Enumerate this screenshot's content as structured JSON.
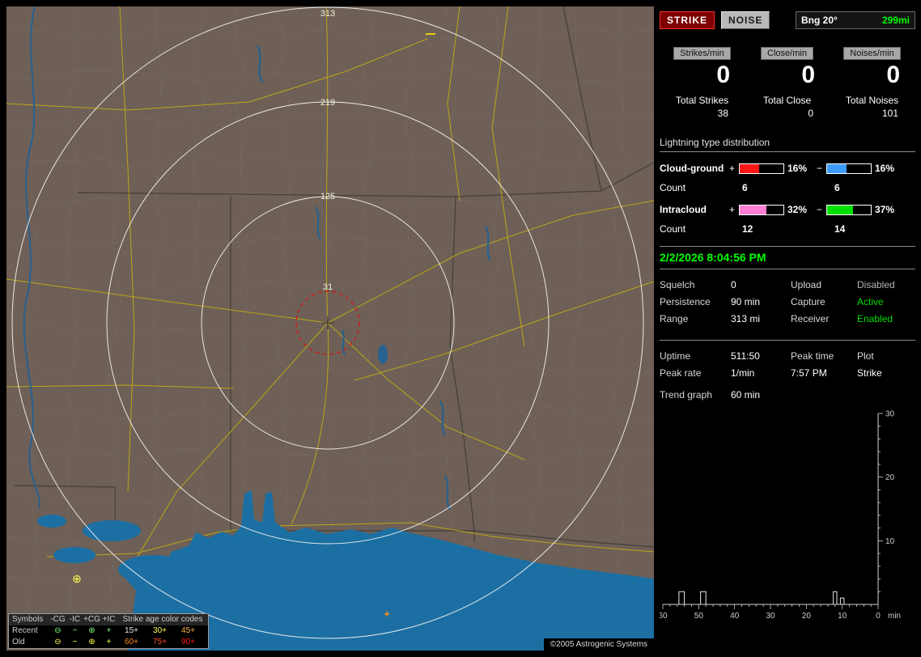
{
  "map": {
    "rings": [
      "313",
      "219",
      "125",
      "31"
    ],
    "markers": [
      {
        "glyph": "⊕",
        "color": "#ffff4d"
      },
      {
        "glyph": "+",
        "color": "#ff8c1a"
      }
    ],
    "legend": {
      "header": {
        "symbols": "Symbols",
        "cols": [
          "-CG",
          "-IC",
          "+CG",
          "+IC"
        ],
        "age_title": "Strike age color codes"
      },
      "rows": [
        {
          "label": "Recent",
          "symbols": [
            "⊖",
            "−",
            "⊕",
            "+"
          ],
          "symbol_color": "#7fff7f",
          "ages": [
            {
              "text": "15+",
              "color": "#e8e8e8"
            },
            {
              "text": "30+",
              "color": "#ffff4d"
            },
            {
              "text": "45+",
              "color": "#ffb347"
            }
          ]
        },
        {
          "label": "Old",
          "symbols": [
            "⊖",
            "−",
            "⊕",
            "+"
          ],
          "symbol_color": "#ffff4d",
          "ages": [
            {
              "text": "60+",
              "color": "#ff8c1a"
            },
            {
              "text": "75+",
              "color": "#ff4d26"
            },
            {
              "text": "90+",
              "color": "#ff1f1f"
            }
          ]
        }
      ]
    },
    "copyright": "©2005 Astrogenic Systems"
  },
  "panel": {
    "strike_button": "STRIKE",
    "noise_button": "NOISE",
    "bng_label": "Bng 20°",
    "bng_range": "299mi",
    "bng_range_color": "#00ff00",
    "counters": [
      {
        "label": "Strikes/min",
        "value": "0",
        "total_label": "Total Strikes",
        "total": "38"
      },
      {
        "label": "Close/min",
        "value": "0",
        "total_label": "Total Close",
        "total": "0"
      },
      {
        "label": "Noises/min",
        "value": "0",
        "total_label": "Total Noises",
        "total": "101"
      }
    ],
    "distribution": {
      "title": "Lightning type distribution",
      "rows": [
        {
          "name": "Cloud-ground",
          "plus_sign": "+",
          "minus_sign": "−",
          "plus_pct": "16%",
          "minus_pct": "16%",
          "plus_fill": "45%",
          "minus_fill": "45%",
          "plus_color": "#ff1515",
          "minus_color": "#3d9bff",
          "count_label": "Count",
          "plus_count": "6",
          "minus_count": "6"
        },
        {
          "name": "Intracloud",
          "plus_sign": "+",
          "minus_sign": "−",
          "plus_pct": "32%",
          "minus_pct": "37%",
          "plus_fill": "62%",
          "minus_fill": "60%",
          "plus_color": "#ff7fd4",
          "minus_color": "#00e000",
          "count_label": "Count",
          "plus_count": "12",
          "minus_count": "14"
        }
      ]
    },
    "timestamp": "2/2/2026 8:04:56 PM",
    "timestamp_color": "#00ff00",
    "status": {
      "rows": [
        {
          "l1": "Squelch",
          "v1": "0",
          "l2": "Upload",
          "v2": "Disabled",
          "v2_color": "#b4b4b4"
        },
        {
          "l1": "Persistence",
          "v1": "90 min",
          "l2": "Capture",
          "v2": "Active",
          "v2_color": "#00dd00"
        },
        {
          "l1": "Range",
          "v1": "313 mi",
          "l2": "Receiver",
          "v2": "Enabled",
          "v2_color": "#00dd00"
        }
      ]
    },
    "stats": {
      "uptime_label": "Uptime",
      "uptime": "511:50",
      "peak_time_label": "Peak time",
      "plot_label": "Plot",
      "peak_rate_label": "Peak rate",
      "peak_rate": "1/min",
      "peak_time": "7:57 PM",
      "plot": "Strike",
      "trend_label": "Trend graph",
      "trend_value": "60 min"
    }
  },
  "chart_data": {
    "type": "line",
    "title": "Strike trend graph, last 60 minutes",
    "xlabel": "min",
    "x_ticks": [
      60,
      50,
      40,
      30,
      20,
      10,
      0
    ],
    "y_ticks": [
      10,
      20,
      30
    ],
    "xlim": [
      60,
      0
    ],
    "ylim": [
      0,
      30
    ],
    "grid": false,
    "series": [
      {
        "name": "Strike",
        "pulses": [
          {
            "from_min": 55.5,
            "to_min": 54,
            "value": 2
          },
          {
            "from_min": 49.5,
            "to_min": 48,
            "value": 2
          },
          {
            "from_min": 12.5,
            "to_min": 11.5,
            "value": 2
          },
          {
            "from_min": 10.5,
            "to_min": 9.5,
            "value": 1
          }
        ]
      }
    ]
  }
}
